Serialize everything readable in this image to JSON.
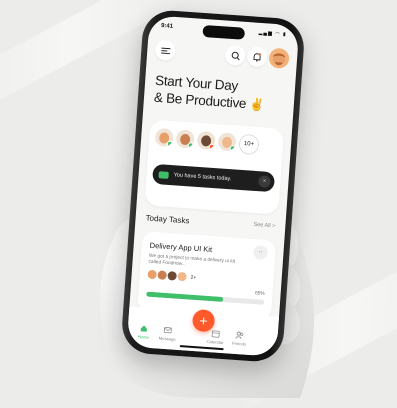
{
  "status": {
    "time": "9:41",
    "icons": "▂▄▆ ◠ ▮"
  },
  "headline": {
    "line1": "Start Your Day",
    "line2": "& Be Productive",
    "emoji": "✌"
  },
  "team": {
    "more_count": "10+"
  },
  "toast": {
    "text": "You have 5 tasks today.",
    "close": "×"
  },
  "tasks_section": {
    "title": "Today Tasks",
    "see_all": "See All >"
  },
  "task": {
    "title": "Delivery App UI Kit",
    "description": "We got a project to make a delivery ui kit called Foodnow...",
    "assignee_extra": "2+",
    "progress_label": "65%",
    "progress": 0.65,
    "more": "··"
  },
  "tabs": [
    {
      "label": "Home"
    },
    {
      "label": "Message"
    },
    {
      "label": "Calendar"
    },
    {
      "label": "Friends"
    }
  ],
  "fab": {
    "label": "+"
  },
  "colors": {
    "accent": "#3fbf6a",
    "fab": "#ff5a2c",
    "toast": "#1e1e1e"
  }
}
